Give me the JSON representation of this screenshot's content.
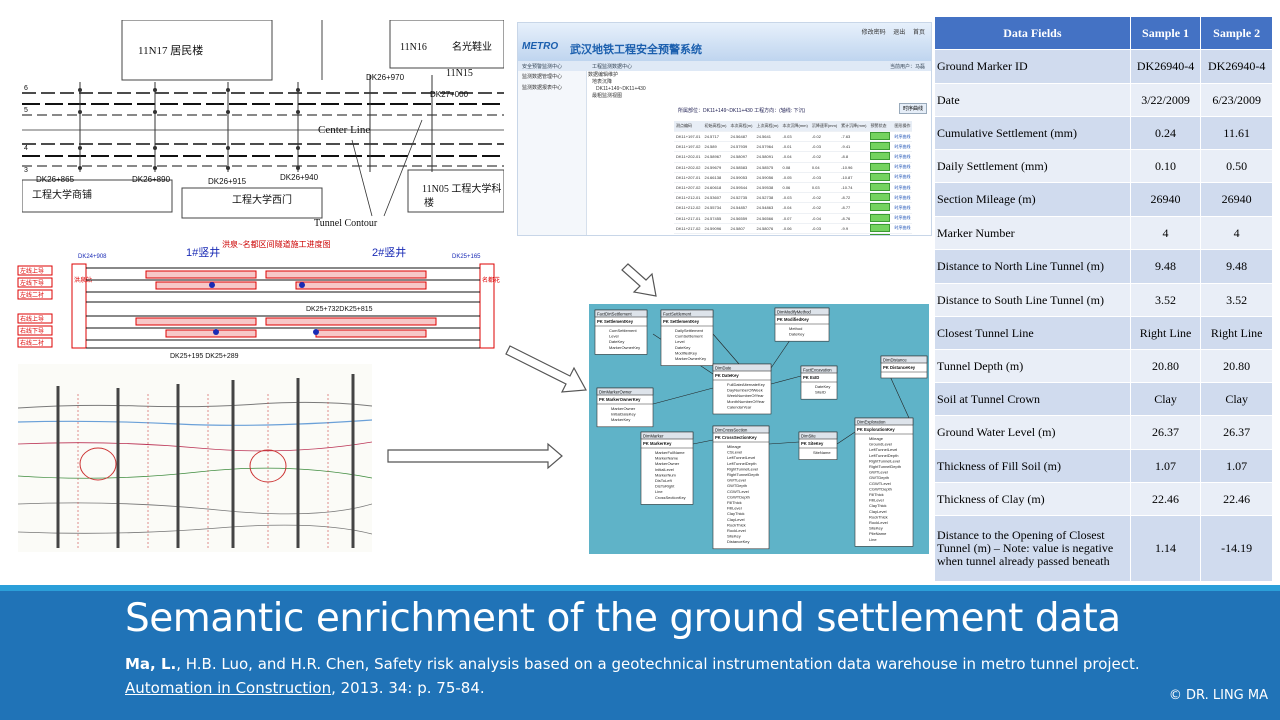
{
  "slide": {
    "title": "Semantic enrichment of the ground settlement data",
    "citation_author_bold": "Ma, L.",
    "citation_rest": ", H.B. Luo, and H.R. Chen, Safety risk analysis based on a geotechnical instrumentation data warehouse in metro tunnel project.",
    "citation_journal": "Automation in Construction",
    "citation_tail": ", 2013. 34: p. 75-84.",
    "copyright": "© DR. LING MA"
  },
  "plan_drawing": {
    "building_1": "11N17 居民楼",
    "building_2": "11N16",
    "building_3": "名光鞋业",
    "building_4": "11N15",
    "building_5": "11N05 工程大学科",
    "building_5b": "楼",
    "shop": "工程大学商铺",
    "gate": "工程大学西门",
    "center_line": "Center Line",
    "tunnel_contour": "Tunnel Contour",
    "marks": [
      "DK26+970",
      "DK27+000",
      "DK26+865",
      "DK26+890",
      "DK26+915",
      "DK26+940"
    ],
    "side_nums": [
      "6",
      "5",
      "4",
      "3"
    ]
  },
  "progress_drawing": {
    "title": "洪泉~名都区间隧道施工进度图",
    "shaft_1": "1#竖井",
    "shaft_2": "2#竖井",
    "start": "DK24+908",
    "end": "DK25+165",
    "bottom_marks": "DK25+195  DK25+289",
    "mid_mark": "DK25+732DK25+815",
    "left_station": "洪泉站",
    "right_station": "名都花园站",
    "left_labels": [
      "左线上导",
      "左线下导",
      "左线二衬",
      "右线上导",
      "右线下导",
      "右线二衬"
    ]
  },
  "app": {
    "logo": "METRO",
    "title": "武汉地铁工程安全预警系统",
    "top_links": [
      "修改密码",
      "退出",
      "首页"
    ],
    "nav_left": "安全预警监测中心",
    "nav_mid": "工程监测数据中心",
    "nav_right": "当前用户：马磊",
    "sidebar": [
      "监测数据管理中心",
      "监测数据报表中心"
    ],
    "tree": [
      "数据编辑维护",
      "地表沉降",
      "DK11+149~DK11+430",
      "最粗监测视图"
    ],
    "query": "所属部位：DK11+149~DK11+430 工程方向：(轴线: 下沉)",
    "query_button": "时序曲线",
    "headers": [
      "测点编码",
      "初始高程(m)",
      "本次高程(m)",
      "上次高程(m)",
      "本次沉降(mm)",
      "沉降速率(mm)",
      "累计沉降(mm)",
      "预警状态",
      "图形操作"
    ],
    "rows": [
      [
        "DK11+197-01",
        "24.5717",
        "24.56487",
        "24.5641",
        "-0.03",
        "-0.02",
        "-7.63"
      ],
      [
        "DK11+197-02",
        "24.589",
        "24.57939",
        "24.57964",
        "-0.01",
        "-0.03",
        "-9.41"
      ],
      [
        "DK11+202-01",
        "24.58967",
        "24.58097",
        "24.58091",
        "-0.04",
        "-0.02",
        "-8.8"
      ],
      [
        "DK11+202-02",
        "24.59679",
        "24.58583",
        "24.58575",
        "0.08",
        "0.04",
        "-10.96"
      ],
      [
        "DK11+207-01",
        "24.66138",
        "24.59053",
        "24.59056",
        "-0.05",
        "-0.03",
        "-10.87"
      ],
      [
        "DK11+207-02",
        "24.60618",
        "24.59544",
        "24.59538",
        "0.06",
        "0.03",
        "-10.74"
      ],
      [
        "DK11+212-01",
        "24.53607",
        "24.52735",
        "24.52738",
        "-0.03",
        "-0.02",
        "-8.72"
      ],
      [
        "DK11+212-02",
        "24.55734",
        "24.54857",
        "24.54863",
        "-0.04",
        "-0.02",
        "-8.77"
      ],
      [
        "DK11+217-01",
        "24.57455",
        "24.56559",
        "24.56566",
        "-0.07",
        "-0.04",
        "-8.76"
      ],
      [
        "DK11+217-02",
        "24.59096",
        "24.5807",
        "24.58076",
        "-0.06",
        "-0.03",
        "-9.9"
      ],
      [
        "DK11+221-01",
        "24.60244",
        "24.59366",
        "24.59374",
        "-0.08",
        "-0.04",
        "-8.78"
      ],
      [
        "DK11+222-02",
        "24.60634",
        "24.59657",
        "24.59662",
        "-0.05",
        "-0.03",
        "-9.77"
      ]
    ],
    "row_link": "时序曲线"
  },
  "schema_tables": [
    {
      "name": "FactDirtSettlement",
      "key": "SettlementKey",
      "fields": [
        "CumSettlement",
        "Level",
        "DateKey",
        "MarkerOwnerKey"
      ]
    },
    {
      "name": "FactSettlement",
      "key": "SettlementKey",
      "fields": [
        "DailySettlement",
        "CumSettlement",
        "Level",
        "DateKey",
        "ModifiedKey",
        "MarkerOwnerKey"
      ]
    },
    {
      "name": "DimModifyMethod",
      "key": "ModifiedKey",
      "fields": [
        "Method",
        "DateKey"
      ]
    },
    {
      "name": "DimDate",
      "key": "DateKey",
      "fields": [
        "FullDateAlternateKey",
        "DayNumberOfWeek",
        "WeekNumberOfYear",
        "MonthNumberOfYear",
        "CalendarYear"
      ]
    },
    {
      "name": "FactExcavation",
      "key": "ExID",
      "fields": [
        "DateKey",
        "SiteID"
      ]
    },
    {
      "name": "DimDistance",
      "key": "DistanceKey",
      "fields": []
    },
    {
      "name": "DimMarkerOwner",
      "key": "MarkerOwnerKey",
      "fields": [
        "MarkerOwner",
        "InitialDateKey",
        "MarkerKey"
      ]
    },
    {
      "name": "DimMarker",
      "key": "MarkerKey",
      "fields": [
        "MarkerFullName",
        "MarkerName",
        "MarkerOwner",
        "InitialLevel",
        "MarkerNum",
        "DisToLeft",
        "DisToRight",
        "Line",
        "CrossSectionKey"
      ]
    },
    {
      "name": "DimCrossSection",
      "key": "CrossSectionKey",
      "fields": [
        "Mileage",
        "CSLevel",
        "LeftTunnelLevel",
        "LeftTunnelDepth",
        "RightTunnelLevel",
        "RightTunnelDepth",
        "GWTLevel",
        "GWTDepth",
        "CGWTLevel",
        "CGWTDepth",
        "FillThick",
        "FillLevel",
        "ClayThick",
        "ClayLevel",
        "RockThick",
        "RockLevel",
        "SiteKey",
        "DistanceKey"
      ]
    },
    {
      "name": "DimSite",
      "key": "SiteKey",
      "fields": [
        "SiteName"
      ]
    },
    {
      "name": "DimExploration",
      "key": "ExplorationKey",
      "fields": [
        "Mileage",
        "GroundLevel",
        "LeftTunnelLevel",
        "LeftTunnelDepth",
        "RightTunnelLevel",
        "RightTunnelDepth",
        "GWTLevel",
        "GWTDepth",
        "CGWTLevel",
        "CGWTDepth",
        "FillThick",
        "FillLevel",
        "ClayThick",
        "ClayLevel",
        "RockThick",
        "RockLevel",
        "SiteKey",
        "PileName",
        "Line"
      ]
    }
  ],
  "data_table": {
    "headers": [
      "Data Fields",
      "Sample 1",
      "Sample 2"
    ],
    "rows": [
      [
        "Ground Marker ID",
        "DK26940-4",
        "DK26940-4"
      ],
      [
        "Date",
        "3/22/2009",
        "6/23/2009"
      ],
      [
        "Cumulative Settlement (mm)",
        "0.24",
        "11.61"
      ],
      [
        "Daily Settlement (mm)",
        "0.10",
        "0.50"
      ],
      [
        "Section Mileage  (m)",
        "26940",
        "26940"
      ],
      [
        "Marker Number",
        "4",
        "4"
      ],
      [
        "Distance to North Line Tunnel (m)",
        "9.48",
        "9.48"
      ],
      [
        "Distance to South Line Tunnel (m)",
        "3.52",
        "3.52"
      ],
      [
        "Closest Tunnel Line",
        "Right Line",
        "Right Line"
      ],
      [
        "Tunnel Depth (m)",
        "20.80",
        "20.80"
      ],
      [
        "Soil at Tunnel Crown",
        "Clay",
        "Clay"
      ],
      [
        "Ground Water Level (m)",
        "26.37",
        "26.37"
      ],
      [
        "Thickness of Fill Soil (m)",
        "1.07",
        "1.07"
      ],
      [
        "Thickness of Clay (m)",
        "22.46",
        "22.46"
      ],
      [
        "Distance to the Opening of Closest Tunnel (m) – Note:  value is negative when tunnel already passed beneath",
        "1.14",
        "-14.19"
      ]
    ]
  },
  "colors": {
    "banner": "#2073b7",
    "stripe": "#2b9fd9",
    "table_header": "#4472c4",
    "table_odd": "#d0dbee",
    "table_even": "#e9eef7",
    "schema_bg": "#5fb3c8"
  }
}
